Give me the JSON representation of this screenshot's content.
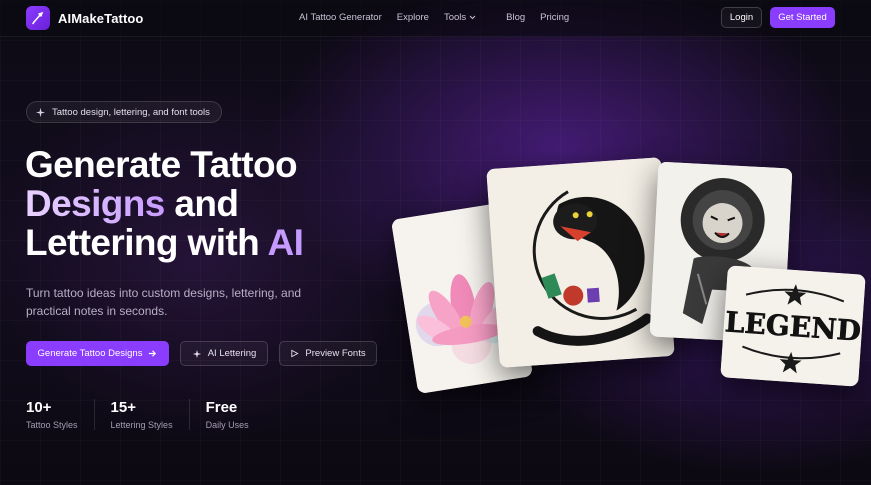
{
  "nav": {
    "brand": "AIMakeTattoo",
    "links": [
      "AI Tattoo Generator",
      "Explore",
      "Tools",
      "Blog",
      "Pricing"
    ],
    "login": "Login",
    "get_started": "Get Started"
  },
  "hero": {
    "pill": "Tattoo design, lettering, and font tools",
    "headline_1": "Generate Tattoo",
    "headline_2a": "Designs",
    "headline_2b": " and",
    "headline_3a": "Lettering with ",
    "headline_3b": "AI",
    "subtitle": "Turn tattoo ideas into custom designs, lettering, and practical notes in seconds.",
    "cta_primary": "Generate Tattoo Designs",
    "cta_lettering": "AI Lettering",
    "cta_fonts": "Preview Fonts",
    "stats": [
      {
        "num": "10+",
        "label": "Tattoo Styles"
      },
      {
        "num": "15+",
        "label": "Lettering Styles"
      },
      {
        "num": "Free",
        "label": "Daily Uses"
      }
    ]
  },
  "gallery": {
    "legend_word": "LEGEND"
  },
  "colors": {
    "accent": "#8a3cff",
    "background": "#0b0812"
  }
}
